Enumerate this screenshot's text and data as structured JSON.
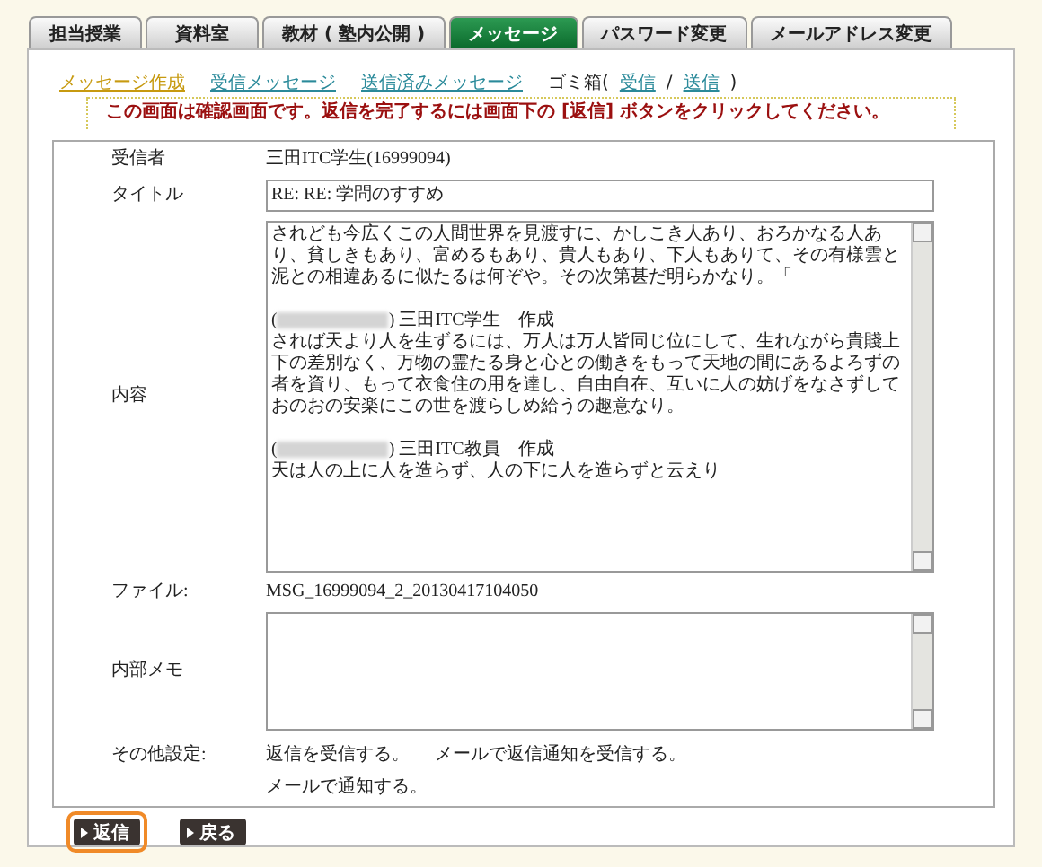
{
  "tabs": [
    {
      "label": "担当授業",
      "selected": false
    },
    {
      "label": "資料室",
      "selected": false
    },
    {
      "label": "教材 ( 塾内公開 )",
      "selected": false
    },
    {
      "label": "メッセージ",
      "selected": true
    },
    {
      "label": "パスワード変更",
      "selected": false
    },
    {
      "label": "メールアドレス変更",
      "selected": false
    }
  ],
  "subnav": {
    "items": [
      {
        "label": "メッセージ作成",
        "selected": true
      },
      {
        "label": "受信メッセージ",
        "selected": false
      },
      {
        "label": "送信済みメッセージ",
        "selected": false
      }
    ],
    "trash": {
      "label": "ゴミ箱(",
      "links": [
        "受信",
        "送信"
      ],
      "separator": "/",
      "close": ")"
    }
  },
  "notice": "この画面は確認画面です。返信を完了するには画面下の [返信] ボタンをクリックしてください。",
  "form": {
    "recipient": {
      "label": "受信者",
      "value": "三田ITC学生(16999094)"
    },
    "title": {
      "label": "タイトル",
      "value": "RE: RE: 学問のすすめ"
    },
    "content": {
      "label": "内容",
      "blocks": [
        {
          "kind": "text",
          "text": "されども今広くこの人間世界を見渡すに、かしこき人あり、おろかなる人あり、貧しきもあり、富めるもあり、貴人もあり、下人もありて、その有様雲と泥との相違あるに似たるは何ぞや。その次第甚だ明らかなり。「"
        },
        {
          "kind": "header",
          "open": "(",
          "close": ")",
          "author": "三田ITC学生　作成"
        },
        {
          "kind": "text",
          "text": "されば天より人を生ずるには、万人は万人皆同じ位にして、生れながら貴賤上下の差別なく、万物の霊たる身と心との働きをもって天地の間にあるよろずの者を資り、もって衣食住の用を達し、自由自在、互いに人の妨げをなさずしておのおの安楽にこの世を渡らしめ給うの趣意なり。"
        },
        {
          "kind": "header",
          "open": "(",
          "close": ")",
          "author": "三田ITC教員　作成"
        },
        {
          "kind": "text",
          "text": "天は人の上に人を造らず、人の下に人を造らずと云えり"
        }
      ]
    },
    "file": {
      "label": "ファイル:",
      "value": "MSG_16999094_2_20130417104050"
    },
    "memo": {
      "label": "内部メモ"
    },
    "settings": {
      "label": "その他設定:",
      "lines": [
        [
          "返信を受信する。",
          "メールで返信通知を受信する。"
        ],
        [
          "メールで通知する。"
        ]
      ]
    }
  },
  "buttons": [
    {
      "label": "返信",
      "highlighted": true
    },
    {
      "label": "戻る",
      "highlighted": false
    }
  ]
}
